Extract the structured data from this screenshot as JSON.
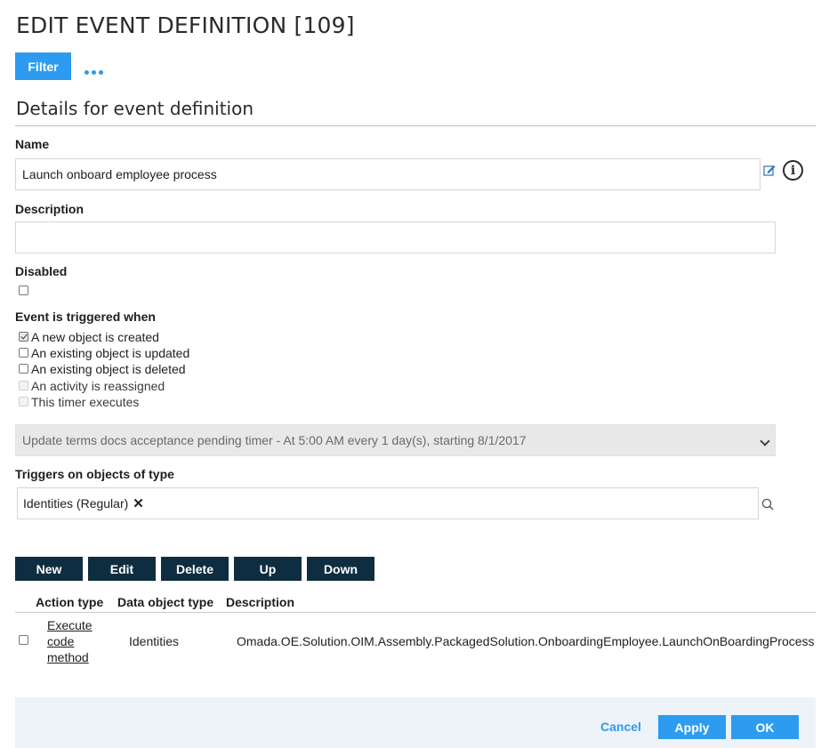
{
  "page": {
    "title": "EDIT EVENT DEFINITION [109]",
    "filter_label": "Filter",
    "section_title": "Details for event definition"
  },
  "form": {
    "name_label": "Name",
    "name_value": "Launch onboard employee process",
    "description_label": "Description",
    "description_value": "",
    "disabled_label": "Disabled",
    "disabled_checked": false,
    "triggered_label": "Event is triggered when",
    "triggers": [
      {
        "label": "A new object is created",
        "checked": true,
        "enabled": true
      },
      {
        "label": "An existing object is updated",
        "checked": false,
        "enabled": true
      },
      {
        "label": "An existing object is deleted",
        "checked": false,
        "enabled": true
      },
      {
        "label": "An activity is reassigned",
        "checked": false,
        "enabled": false
      },
      {
        "label": "This timer executes",
        "checked": false,
        "enabled": false
      }
    ],
    "timer_selected": "Update terms docs acceptance pending timer - At 5:00 AM every 1 day(s), starting 8/1/2017",
    "object_type_label": "Triggers on objects of type",
    "object_type_tag": "Identities (Regular)",
    "tag_remove": "✕"
  },
  "actions_toolbar": {
    "new": "New",
    "edit": "Edit",
    "delete": "Delete",
    "up": "Up",
    "down": "Down"
  },
  "actions_table": {
    "columns": [
      "Action type",
      "Data object type",
      "Description"
    ],
    "rows": [
      {
        "action_type": [
          "Execute",
          "code",
          "method"
        ],
        "data_object_type": "Identities",
        "description": "Omada.OE.Solution.OIM.Assembly.PackagedSolution.OnboardingEmployee.LaunchOnBoardingProcess"
      }
    ]
  },
  "footer": {
    "cancel": "Cancel",
    "apply": "Apply",
    "ok": "OK"
  },
  "icons": {
    "more": "more-horizontal-icon",
    "edit": "edit-icon",
    "info": "info-icon",
    "search": "search-icon",
    "chevron": "chevron-down-icon"
  },
  "colors": {
    "primary": "#2d9cf0",
    "dark_button": "#0f2d40",
    "footer_bg": "#eef3f9",
    "select_bg": "#e8e8e8"
  }
}
